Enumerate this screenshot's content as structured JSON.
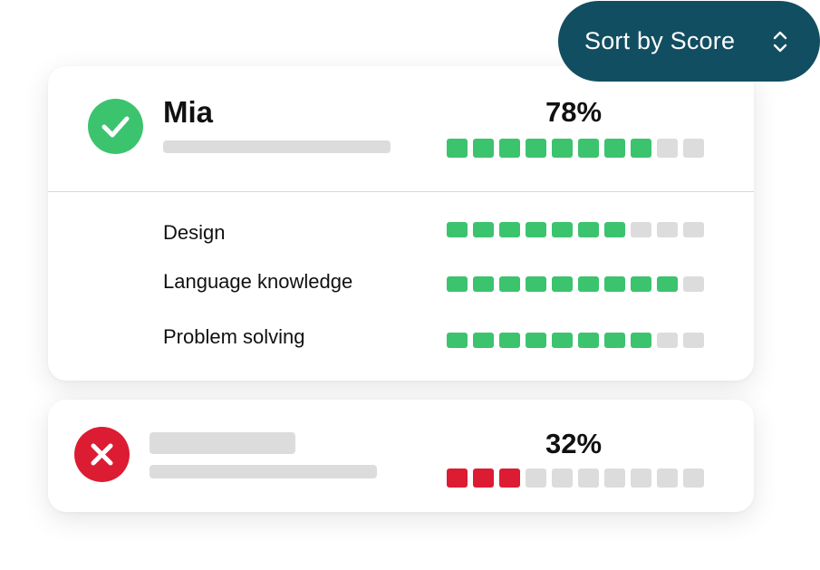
{
  "sort": {
    "label": "Sort by Score",
    "icon": "sort-updown-icon"
  },
  "colors": {
    "accent": "#124e61",
    "pass": "#3cc36e",
    "fail": "#dc1c33",
    "empty": "#dcdcdc"
  },
  "candidates": [
    {
      "name": "Mia",
      "status": "pass",
      "status_icon": "checkmark-icon",
      "score_label": "78%",
      "score_filled": 8,
      "score_total": 10,
      "skills": [
        {
          "label": "Design",
          "filled": 7,
          "total": 10
        },
        {
          "label": "Language knowledge",
          "filled": 9,
          "total": 10
        },
        {
          "label": "Problem solving",
          "filled": 8,
          "total": 10
        }
      ]
    },
    {
      "name": "",
      "status": "fail",
      "status_icon": "x-icon",
      "score_label": "32%",
      "score_filled": 3,
      "score_total": 10
    }
  ]
}
